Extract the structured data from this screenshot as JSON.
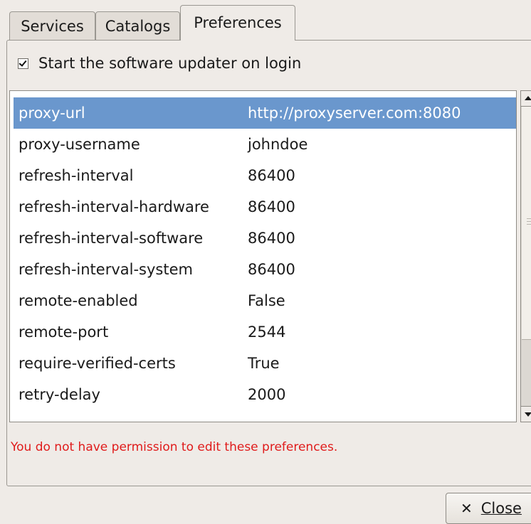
{
  "tabs": [
    {
      "label": "Services"
    },
    {
      "label": "Catalogs"
    },
    {
      "label": "Preferences"
    }
  ],
  "active_tab": "Preferences",
  "startup_checkbox": {
    "label": "Start the software updater on login",
    "checked": true
  },
  "preferences": [
    {
      "key": "proxy-url",
      "value": "http://proxyserver.com:8080",
      "selected": true
    },
    {
      "key": "proxy-username",
      "value": "johndoe"
    },
    {
      "key": "refresh-interval",
      "value": "86400"
    },
    {
      "key": "refresh-interval-hardware",
      "value": "86400"
    },
    {
      "key": "refresh-interval-software",
      "value": "86400"
    },
    {
      "key": "refresh-interval-system",
      "value": "86400"
    },
    {
      "key": "remote-enabled",
      "value": "False"
    },
    {
      "key": "remote-port",
      "value": "2544"
    },
    {
      "key": "require-verified-certs",
      "value": "True"
    },
    {
      "key": "retry-delay",
      "value": "2000"
    }
  ],
  "error_message": "You do not have permission to edit these preferences.",
  "close_button": {
    "label": "Close",
    "icon": "close-icon"
  },
  "colors": {
    "selection": "#6a97cd",
    "error": "#e01b1b",
    "window_bg": "#efebe7"
  }
}
